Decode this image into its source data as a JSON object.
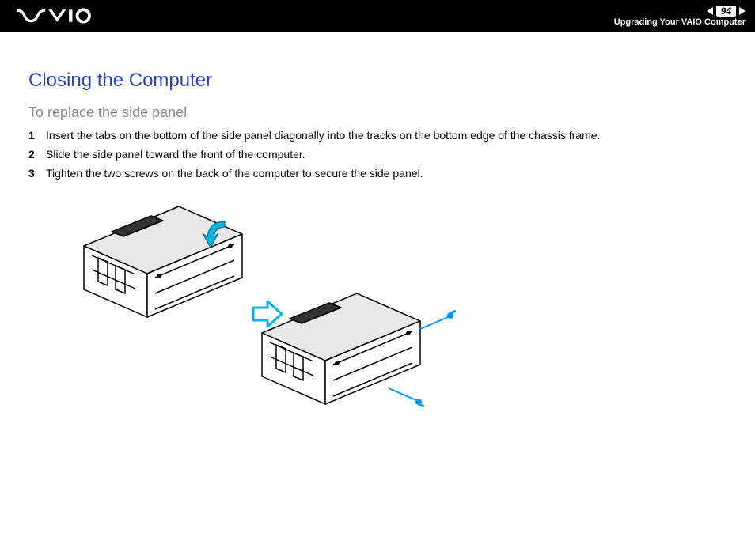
{
  "header": {
    "page_number": "94",
    "section_title": "Upgrading Your VAIO Computer"
  },
  "content": {
    "heading": "Closing the Computer",
    "subheading": "To replace the side panel",
    "steps": [
      "Insert the tabs on the bottom of the side panel diagonally into the tracks on the bottom edge of the chassis frame.",
      "Slide the side panel toward the front of the computer.",
      "Tighten the two screws on the back of the computer to secure the side panel."
    ]
  }
}
